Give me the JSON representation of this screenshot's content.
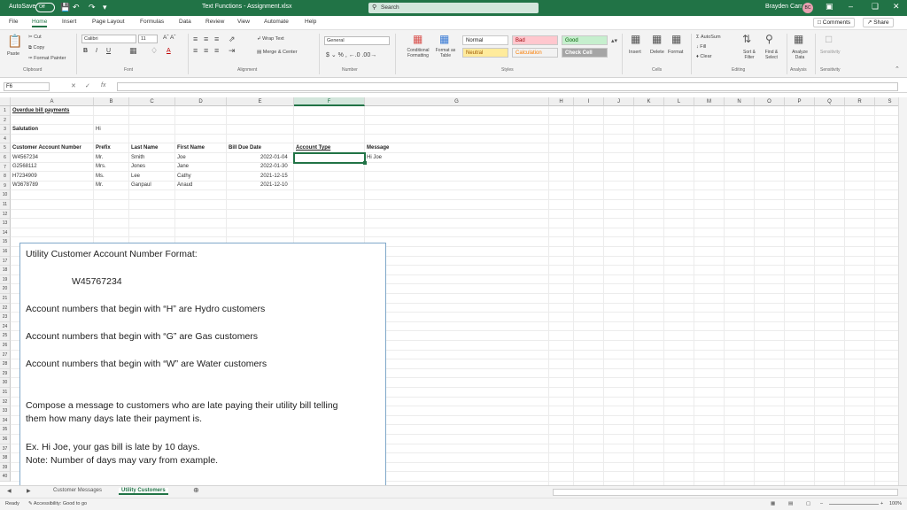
{
  "titlebar": {
    "autosave": "AutoSave",
    "toggle": "Off",
    "doc_title": "Text Functions - Assignment.xlsx",
    "search_placeholder": "Search",
    "user_name": "Brayden Carr",
    "user_initials": "BC"
  },
  "tabs": [
    "File",
    "Home",
    "Insert",
    "Page Layout",
    "Formulas",
    "Data",
    "Review",
    "View",
    "Automate",
    "Help"
  ],
  "active_tab": "Home",
  "comments_label": "Comments",
  "share_label": "Share",
  "ribbon": {
    "paste": "Paste",
    "cut": "Cut",
    "copy": "Copy",
    "format_painter": "Format Painter",
    "clipboard": "Clipboard",
    "font_name": "Calibri",
    "font_size": "11",
    "font_group": "Font",
    "wrap_text": "Wrap Text",
    "merge_center": "Merge & Center",
    "alignment": "Alignment",
    "number_format": "General",
    "number_group": "Number",
    "conditional": "Conditional Formatting",
    "format_table": "Format as Table",
    "styles_group": "Styles",
    "style_normal": "Normal",
    "style_bad": "Bad",
    "style_good": "Good",
    "style_neutral": "Neutral",
    "style_calc": "Calculation",
    "style_check": "Check Cell",
    "insert": "Insert",
    "delete": "Delete",
    "format": "Format",
    "cells_group": "Cells",
    "autosum": "AutoSum",
    "fill": "Fill",
    "clear": "Clear",
    "sort_filter": "Sort & Filter",
    "find_select": "Find & Select",
    "editing_group": "Editing",
    "analyze": "Analyze Data",
    "analysis_group": "Analysis",
    "sensitivity": "Sensitivity",
    "sensitivity_group": "Sensitivity",
    "colors": {
      "accent": "#217346",
      "bad_bg": "#ffc7ce",
      "bad_fg": "#9c0006",
      "good_bg": "#c6efce",
      "good_fg": "#006100",
      "neutral_bg": "#ffeb9c",
      "neutral_fg": "#9c5700",
      "calc_bg": "#f2f2f2",
      "calc_fg": "#fa7d00",
      "check_bg": "#a5a5a5"
    }
  },
  "formula_bar": {
    "name_box": "F6",
    "fx": "fx",
    "value": ""
  },
  "columns": [
    "A",
    "B",
    "C",
    "D",
    "E",
    "F",
    "G",
    "H",
    "I",
    "J",
    "K",
    "L",
    "M",
    "N",
    "O",
    "P",
    "Q",
    "R",
    "S"
  ],
  "selected_column": "F",
  "sheet": {
    "title": "Overdue bill payments",
    "salutation_label": "Salutation",
    "salutation_value": "Hi",
    "headers": [
      "Customer Account Number",
      "Prefix",
      "Last Name",
      "First Name",
      "Bill Due Date",
      "Account Type",
      "Message"
    ],
    "rows": [
      [
        "W4567234",
        "Mr.",
        "Smith",
        "Joe",
        "2022-01-04",
        "",
        "Hi Joe"
      ],
      [
        "G2568112",
        "Mrs.",
        "Jones",
        "Jane",
        "2022-01-30",
        "",
        ""
      ],
      [
        "H7234909",
        "Ms.",
        "Lee",
        "Cathy",
        "2021-12-15",
        "",
        ""
      ],
      [
        "W3678789",
        "Mr.",
        "Ganpaul",
        "Anaud",
        "2021-12-10",
        "",
        ""
      ]
    ]
  },
  "textbox": {
    "line1": "Utility Customer Account Number Format:",
    "line2": "W45767234",
    "line3": "Account numbers that begin with “H” are Hydro customers",
    "line4": "Account numbers that begin with “G” are Gas customers",
    "line5": "Account numbers that begin with “W” are Water customers",
    "line6": "Compose a message to customers who are late paying their utility bill telling",
    "line7": "them how many days late their payment is.",
    "line8": "Ex. Hi Joe, your gas bill is late by 10 days.",
    "line9": "Note: Number of days may vary from example."
  },
  "sheet_tabs": [
    "Customer Messages",
    "Utility Customers"
  ],
  "active_sheet": "Utility Customers",
  "status": {
    "ready": "Ready",
    "accessibility": "Accessibility: Good to go",
    "zoom": "100%"
  }
}
